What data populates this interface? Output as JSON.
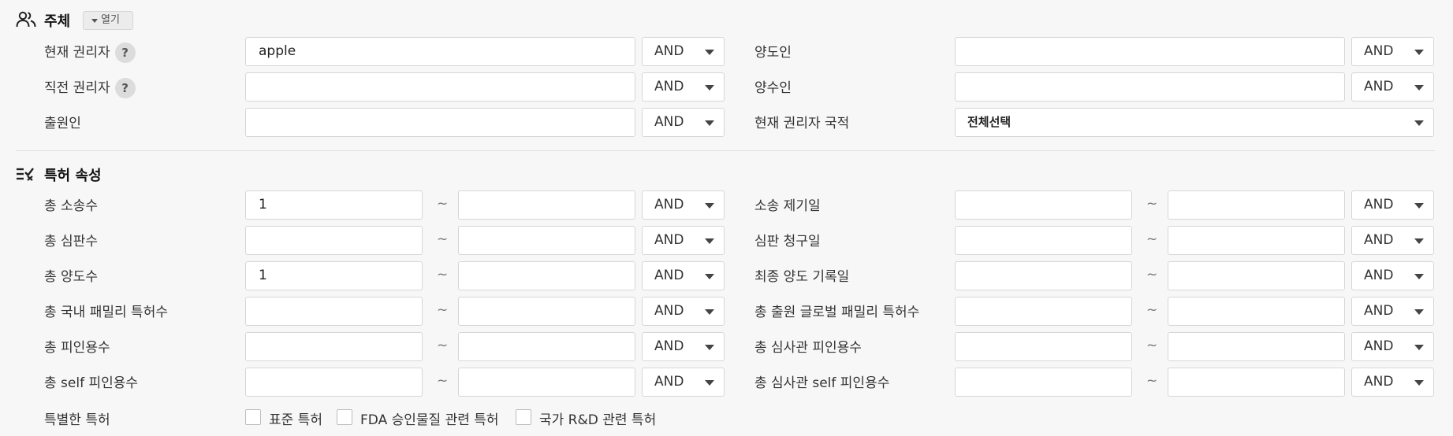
{
  "subject": {
    "title": "주체",
    "toggle_label": "열기",
    "rows": [
      {
        "label": "현재 권리자",
        "help": "?",
        "value": "apple",
        "op": "AND"
      },
      {
        "label": "직전 권리자",
        "help": "?",
        "value": "",
        "op": "AND"
      },
      {
        "label": "출원인",
        "value": "",
        "op": "AND"
      }
    ],
    "right_rows": [
      {
        "label": "양도인",
        "value": "",
        "op": "AND"
      },
      {
        "label": "양수인",
        "value": "",
        "op": "AND"
      },
      {
        "label": "현재 권리자 국적",
        "select": "전체선택"
      }
    ]
  },
  "attributes": {
    "title": "특허 속성",
    "tilde": "~",
    "left_rows": [
      {
        "label": "총 소송수",
        "from": "1",
        "to": "",
        "op": "AND"
      },
      {
        "label": "총 심판수",
        "from": "",
        "to": "",
        "op": "AND"
      },
      {
        "label": "총 양도수",
        "from": "1",
        "to": "",
        "op": "AND"
      },
      {
        "label": "총 국내 패밀리 특허수",
        "from": "",
        "to": "",
        "op": "AND"
      },
      {
        "label": "총 피인용수",
        "from": "",
        "to": "",
        "op": "AND"
      },
      {
        "label": "총 self 피인용수",
        "from": "",
        "to": "",
        "op": "AND"
      }
    ],
    "right_rows": [
      {
        "label": "소송 제기일",
        "from": "",
        "to": "",
        "op": "AND"
      },
      {
        "label": "심판 청구일",
        "from": "",
        "to": "",
        "op": "AND"
      },
      {
        "label": "최종 양도 기록일",
        "from": "",
        "to": "",
        "op": "AND"
      },
      {
        "label": "총 출원 글로벌 패밀리 특허수",
        "from": "",
        "to": "",
        "op": "AND"
      },
      {
        "label": "총 심사관 피인용수",
        "from": "",
        "to": "",
        "op": "AND"
      },
      {
        "label": "총 심사관 self 피인용수",
        "from": "",
        "to": "",
        "op": "AND"
      }
    ],
    "special": {
      "label": "특별한 특허",
      "options": [
        "표준 특허",
        "FDA 승인물질 관련 특허",
        "국가 R&D 관련 특허"
      ]
    }
  }
}
